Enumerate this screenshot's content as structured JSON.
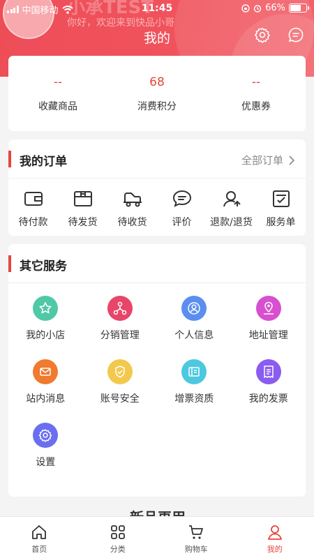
{
  "status_bar": {
    "carrier": "中国移动",
    "time": "11:45",
    "battery": "66%",
    "battery_level": 0.66
  },
  "header": {
    "username": "小承TEST",
    "welcome": "你好，欢迎来到快品小哥",
    "title": "我的"
  },
  "stats": [
    {
      "value": "--",
      "label": "收藏商品"
    },
    {
      "value": "68",
      "label": "消费积分"
    },
    {
      "value": "--",
      "label": "优惠券"
    }
  ],
  "orders": {
    "title": "我的订单",
    "all_label": "全部订单",
    "items": [
      {
        "label": "待付款",
        "icon": "wallet-icon"
      },
      {
        "label": "待发货",
        "icon": "box-icon"
      },
      {
        "label": "待收货",
        "icon": "truck-icon"
      },
      {
        "label": "评价",
        "icon": "comment-icon"
      },
      {
        "label": "退款/退货",
        "icon": "refund-icon"
      },
      {
        "label": "服务单",
        "icon": "service-form-icon"
      }
    ]
  },
  "services": {
    "title": "其它服务",
    "items": [
      {
        "label": "我的小店",
        "icon": "star-icon",
        "color": "#4fc8a6"
      },
      {
        "label": "分销管理",
        "icon": "network-icon",
        "color": "#e8456a"
      },
      {
        "label": "个人信息",
        "icon": "person-icon",
        "color": "#5b8ef0"
      },
      {
        "label": "地址管理",
        "icon": "location-icon",
        "color": "#d84fd0"
      },
      {
        "label": "站内消息",
        "icon": "mail-icon",
        "color": "#f07a2e"
      },
      {
        "label": "账号安全",
        "icon": "shield-icon",
        "color": "#f2c94c"
      },
      {
        "label": "增票资质",
        "icon": "ticket-icon",
        "color": "#4cc8e0"
      },
      {
        "label": "我的发票",
        "icon": "invoice-icon",
        "color": "#8a5cf0"
      },
      {
        "label": "设置",
        "icon": "gear-icon",
        "color": "#6a6ef0"
      }
    ]
  },
  "peek_text": "新品再用",
  "tabs": [
    {
      "label": "首页",
      "icon": "home-icon"
    },
    {
      "label": "分类",
      "icon": "category-icon"
    },
    {
      "label": "购物车",
      "icon": "cart-icon"
    },
    {
      "label": "我的",
      "icon": "user-icon",
      "active": true
    }
  ],
  "colors": {
    "accent": "#e8453c",
    "header": "#ef4f59"
  }
}
